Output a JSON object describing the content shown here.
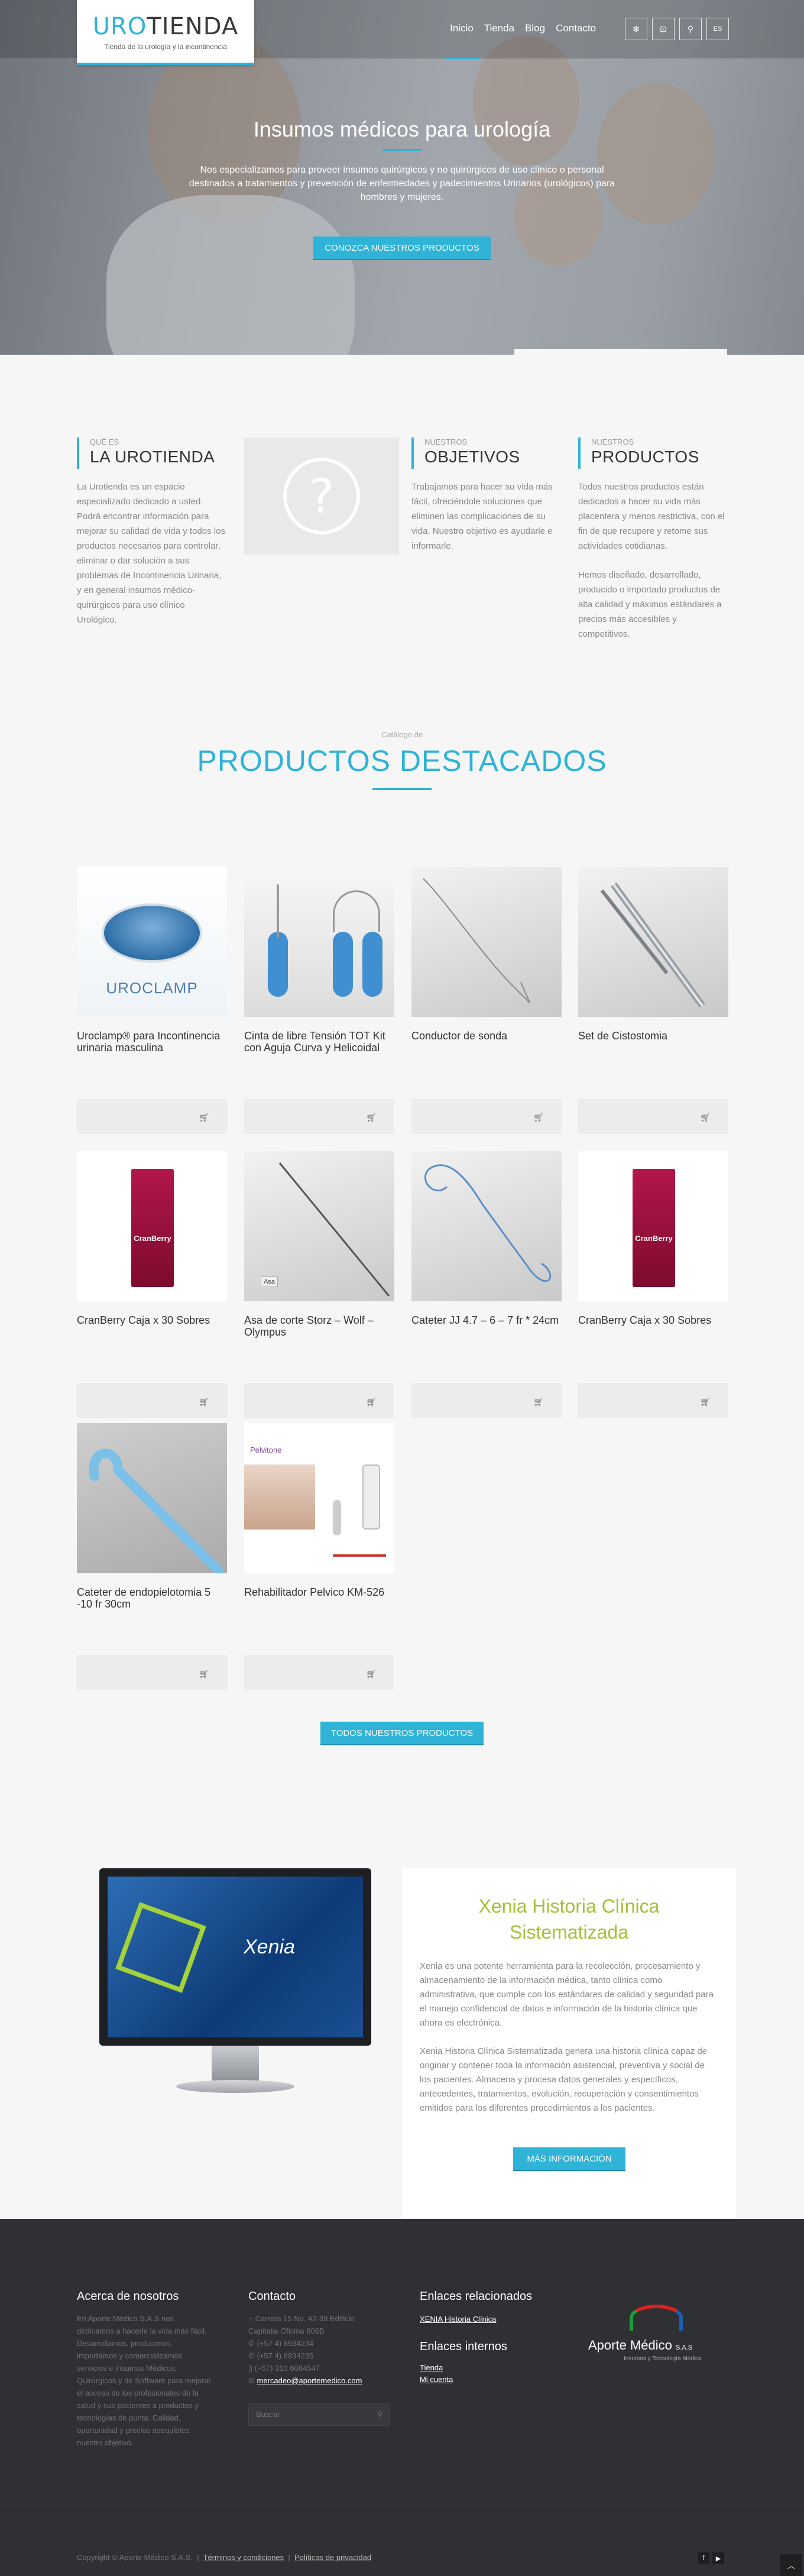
{
  "brand": {
    "name_part1": "URO",
    "name_part2": "TIENDA",
    "tagline": "Tienda de la urología y la incontinencia"
  },
  "nav": {
    "items": [
      "Inicio",
      "Tienda",
      "Blog",
      "Contacto"
    ],
    "active": "Inicio",
    "icons": [
      "settings-icon",
      "cart-icon",
      "search-icon"
    ],
    "lang": "ES"
  },
  "hero": {
    "title": "Insumos médicos para urología",
    "subtitle": "Nos especializamos para proveer insumos quirúrgicos y no quirúrgicos de uso clínico o personal destinados a tratamientos y prevención de enfermedades y padecimientos Urinarios (urológicos) para hombres y mujeres.",
    "cta": "CONOZCA NUESTROS PRODUCTOS"
  },
  "intro": [
    {
      "kicker": "QUÉ ES",
      "title": "LA UROTIENDA",
      "text": "La Urotienda es un espacio especializado dedicado a usted. Podrá encontrar información para mejorar su calidad de vida y todos los productos necesarios para  controlar, eliminar o dar solución a sus problemas de Incontinencia Urinaria, y en general insumos médico-quirúrgicos  para uso clínico Urológico."
    },
    {
      "kicker": "NUESTROS",
      "title": "OBJETIVOS",
      "text": "Trabajamos para hacer su vida más fácil, ofreciéndole soluciones que eliminen las complicaciones de su vida. Nuestro objetivo es ayudarle e informarle."
    },
    {
      "kicker": "NUESTROS",
      "title": "PRODUCTOS",
      "text": "Todos nuestros productos están dedicados a hacer su vida más placentera y menos restrictiva, con el fin de que recupere y retome sus actividades cotidianas.",
      "text2": "Hemos diseñado, desarrollado, producido o importado productos de alta calidad y máximos estándares a precios más accesibles y competitivos."
    }
  ],
  "products": {
    "kicker": "Catálogo de",
    "title": "PRODUCTOS DESTACADOS",
    "items": [
      {
        "name": "Uroclamp® para Incontinencia urinaria masculina",
        "img_label": "UROCLAMP"
      },
      {
        "name": "Cinta de libre Tensión TOT Kit con Aguja Curva y Helicoidal"
      },
      {
        "name": "Conductor de sonda"
      },
      {
        "name": "Set de Cistostomia"
      },
      {
        "name": "CranBerry Caja x 30 Sobres",
        "img_label": "CranBerry"
      },
      {
        "name": "Asa de corte Storz – Wolf – Olympus",
        "img_label": "Asa"
      },
      {
        "name": "Cateter JJ 4.7 – 6 – 7 fr * 24cm"
      },
      {
        "name": "CranBerry Caja x 30 Sobres",
        "img_label": "CranBerry"
      },
      {
        "name": "Cateter de endopielotomia 5 -10 fr 30cm"
      },
      {
        "name": "Rehabilitador Pelvico KM-526",
        "img_label": "Pelvitone"
      }
    ],
    "all_button": "TODOS NUESTROS PRODUCTOS"
  },
  "xenia": {
    "title": "Xenia Historia Clínica Sistematizada",
    "screen_label": "Xenia",
    "p1": "Xenia es una potente herramienta para la recolección, procesamiento y almacenamiento de la información médica, tanto clínica como administrativa, que cumple con los estándares de calidad y seguridad para el manejo confidencial de datos e información de la historia clínica que ahora es electrónica.",
    "p2": "Xenia Historia Clínica Sistematizada genera una historia clínica capaz de originar y contener toda la información asistencial, preventiva y social de los pacientes. Almacena y procesa datos generales y específicos, antecedentes, tratamientos, evolución, recuperación y consentimientos emitidos para los diferentes procedimientos a los pacientes.",
    "button": "MÁS INFORMACIÓN"
  },
  "footer": {
    "about_title": "Acerca de nosotros",
    "about_text": "En Aporte Médico S.A.S nos dedicamos a hacerle la vida más fácil. Desarrollamos, producimos, importamos y comercializamos servicios e insumos Médicos, Quirúrgicos y de Software para mejorar el acceso de los profesionales de la salud y sus pacientes a productos y tecnologías de punta. Calidad, oportunidad y precios asequibles nuestro objetivo.",
    "contact_title": "Contacto",
    "contact_lines": [
      "Carrera 15 No. 42-39 Edificio Capitalia Oficina 806B",
      "(+57 4) 8934234",
      "(+57 4) 8934235",
      "(+57) 310 6084547"
    ],
    "contact_email": "mercadeo@aportemedico.com",
    "search_placeholder": "Buscar",
    "related_title": "Enlaces relacionados",
    "related_links": [
      "XENIA Historia Clínica"
    ],
    "internal_title": "Enlaces internos",
    "internal_links": [
      "Tienda",
      "Mi cuenta"
    ],
    "partner_name": "Aporte Médico",
    "partner_suffix": "S.A.S",
    "partner_tagline": "Insumos y Tecnología Médica",
    "copyright": "Copyright © Aporte Médico S.A.S.",
    "legal_links": [
      "Términos y condiciones",
      "Políticas de privacidad"
    ],
    "social": [
      "facebook-icon",
      "youtube-icon"
    ]
  },
  "colors": {
    "accent": "#2fb3d6",
    "xenia_green": "#a4c135",
    "footer_bg": "#2f3033"
  }
}
